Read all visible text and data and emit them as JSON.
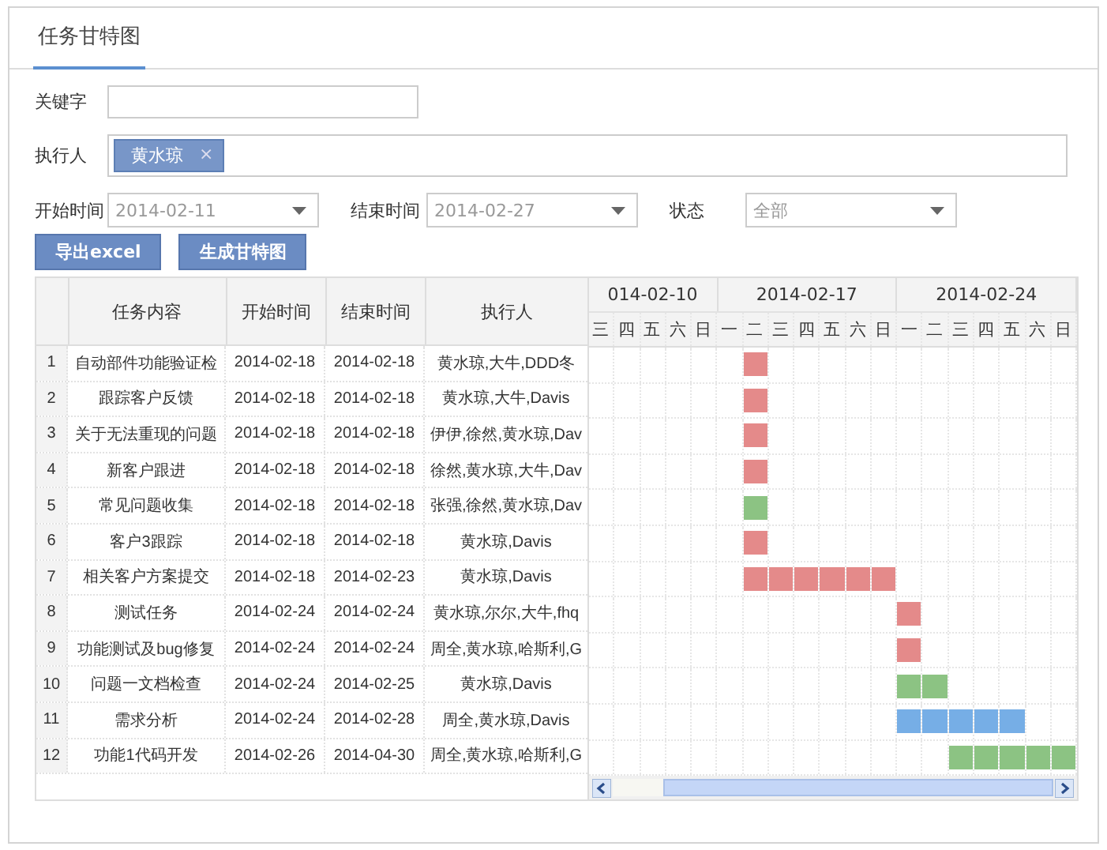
{
  "tabs": [
    {
      "label": "任务甘特图",
      "selected": true
    }
  ],
  "filters": {
    "keyword": {
      "label": "关键字"
    },
    "executor": {
      "label": "执行人",
      "tags": [
        "黄水琼"
      ],
      "tag_remove": "×"
    },
    "start": {
      "label": "开始时间",
      "value": "2014-02-11"
    },
    "end": {
      "label": "结束时间",
      "value": "2014-02-27"
    },
    "status": {
      "label": "状态",
      "value": "全部"
    }
  },
  "buttons": [
    "导出excel",
    "生成甘特图"
  ],
  "table": {
    "columns": [
      "",
      "任务内容",
      "开始时间",
      "结束时间",
      "执行人"
    ],
    "weeks": [
      {
        "label": "014-02-10",
        "days": [
          "三",
          "四",
          "五",
          "六",
          "日"
        ]
      },
      {
        "label": "2014-02-17",
        "days": [
          "一",
          "二",
          "三",
          "四",
          "五",
          "六",
          "日"
        ]
      },
      {
        "label": "2014-02-24",
        "days": [
          "一",
          "二",
          "三",
          "四",
          "五",
          "六",
          "日"
        ]
      }
    ],
    "rows": [
      {
        "no": "1",
        "task": "自动部件功能验证检",
        "start": "2014-02-18",
        "end": "2014-02-18",
        "executor": "黄水琼,大牛,DDD冬",
        "color": "#e48a8a",
        "days": [
          false,
          false,
          false,
          false,
          false,
          false,
          true,
          false,
          false,
          false,
          false,
          false,
          false,
          false,
          false,
          false,
          false,
          false,
          false
        ]
      },
      {
        "no": "2",
        "task": "跟踪客户反馈",
        "start": "2014-02-18",
        "end": "2014-02-18",
        "executor": "黄水琼,大牛,Davis",
        "color": "#e48a8a",
        "days": [
          false,
          false,
          false,
          false,
          false,
          false,
          true,
          false,
          false,
          false,
          false,
          false,
          false,
          false,
          false,
          false,
          false,
          false,
          false
        ]
      },
      {
        "no": "3",
        "task": "关于无法重现的问题",
        "start": "2014-02-18",
        "end": "2014-02-18",
        "executor": "伊伊,徐然,黄水琼,Dav",
        "color": "#e48a8a",
        "days": [
          false,
          false,
          false,
          false,
          false,
          false,
          true,
          false,
          false,
          false,
          false,
          false,
          false,
          false,
          false,
          false,
          false,
          false,
          false
        ]
      },
      {
        "no": "4",
        "task": "新客户跟进",
        "start": "2014-02-18",
        "end": "2014-02-18",
        "executor": "徐然,黄水琼,大牛,Dav",
        "color": "#e48a8a",
        "days": [
          false,
          false,
          false,
          false,
          false,
          false,
          true,
          false,
          false,
          false,
          false,
          false,
          false,
          false,
          false,
          false,
          false,
          false,
          false
        ]
      },
      {
        "no": "5",
        "task": "常见问题收集",
        "start": "2014-02-18",
        "end": "2014-02-18",
        "executor": "张强,徐然,黄水琼,Dav",
        "color": "#8cc383",
        "days": [
          false,
          false,
          false,
          false,
          false,
          false,
          true,
          false,
          false,
          false,
          false,
          false,
          false,
          false,
          false,
          false,
          false,
          false,
          false
        ]
      },
      {
        "no": "6",
        "task": "客户3跟踪",
        "start": "2014-02-18",
        "end": "2014-02-18",
        "executor": "黄水琼,Davis",
        "color": "#e48a8a",
        "days": [
          false,
          false,
          false,
          false,
          false,
          false,
          true,
          false,
          false,
          false,
          false,
          false,
          false,
          false,
          false,
          false,
          false,
          false,
          false
        ]
      },
      {
        "no": "7",
        "task": "相关客户方案提交",
        "start": "2014-02-18",
        "end": "2014-02-23",
        "executor": "黄水琼,Davis",
        "color": "#e48a8a",
        "days": [
          false,
          false,
          false,
          false,
          false,
          false,
          true,
          true,
          true,
          true,
          true,
          true,
          false,
          false,
          false,
          false,
          false,
          false,
          false
        ]
      },
      {
        "no": "8",
        "task": "测试任务",
        "start": "2014-02-24",
        "end": "2014-02-24",
        "executor": "黄水琼,尔尔,大牛,fhq",
        "color": "#e48a8a",
        "days": [
          false,
          false,
          false,
          false,
          false,
          false,
          false,
          false,
          false,
          false,
          false,
          false,
          true,
          false,
          false,
          false,
          false,
          false,
          false
        ]
      },
      {
        "no": "9",
        "task": "功能测试及bug修复",
        "start": "2014-02-24",
        "end": "2014-02-24",
        "executor": "周全,黄水琼,哈斯利,G",
        "color": "#e48a8a",
        "days": [
          false,
          false,
          false,
          false,
          false,
          false,
          false,
          false,
          false,
          false,
          false,
          false,
          true,
          false,
          false,
          false,
          false,
          false,
          false
        ]
      },
      {
        "no": "10",
        "task": "问题一文档检查",
        "start": "2014-02-24",
        "end": "2014-02-25",
        "executor": "黄水琼,Davis",
        "color": "#8cc383",
        "days": [
          false,
          false,
          false,
          false,
          false,
          false,
          false,
          false,
          false,
          false,
          false,
          false,
          true,
          true,
          false,
          false,
          false,
          false,
          false
        ]
      },
      {
        "no": "11",
        "task": "需求分析",
        "start": "2014-02-24",
        "end": "2014-02-28",
        "executor": "周全,黄水琼,Davis",
        "color": "#76aee6",
        "days": [
          false,
          false,
          false,
          false,
          false,
          false,
          false,
          false,
          false,
          false,
          false,
          false,
          true,
          true,
          true,
          true,
          true,
          false,
          false
        ]
      },
      {
        "no": "12",
        "task": "功能1代码开发",
        "start": "2014-02-26",
        "end": "2014-04-30",
        "executor": "周全,黄水琼,哈斯利,G",
        "color": "#8cc383",
        "days": [
          false,
          false,
          false,
          false,
          false,
          false,
          false,
          false,
          false,
          false,
          false,
          false,
          false,
          false,
          true,
          true,
          true,
          true,
          true
        ]
      }
    ]
  }
}
